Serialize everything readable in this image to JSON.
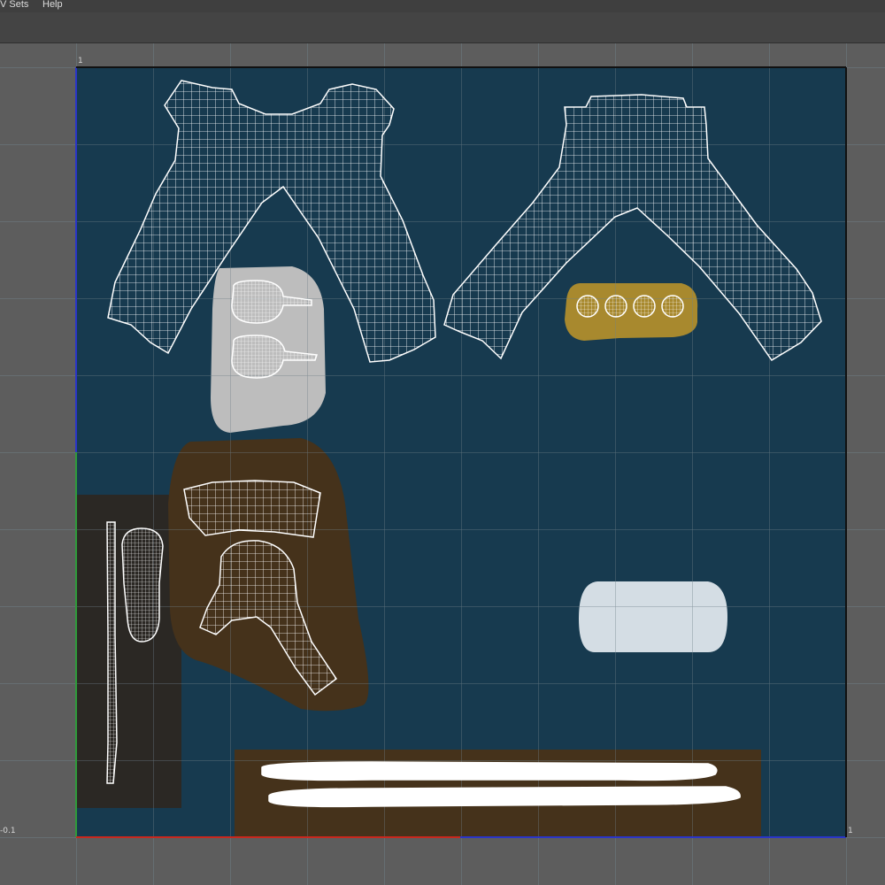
{
  "menubar": {
    "items": [
      {
        "label": "V Sets"
      },
      {
        "label": "Help"
      }
    ]
  },
  "uv_editor": {
    "labels": {
      "top_left": "1",
      "bottom_left": "-0.1",
      "bottom_right": "1"
    },
    "colors": {
      "viewport_background": "#5d5d5d",
      "tile_fill": "#173a4f",
      "grid_line": "#6f7f88",
      "uv_wire": "#ffffff",
      "u_axis": "#c8281e",
      "v_axis": "#2e9a3a",
      "tile_border_blue": "#2a35c8"
    },
    "texture_regions": [
      {
        "name": "grey-patch",
        "color": "#bdbdbd"
      },
      {
        "name": "gold-buttons-patch",
        "color": "#a8892e"
      },
      {
        "name": "brown-boot-patch",
        "color": "#45321b"
      },
      {
        "name": "dark-side-patch",
        "color": "#2b2824"
      },
      {
        "name": "light-blue-patch",
        "color": "#d4dde4"
      },
      {
        "name": "brown-strip-patch",
        "color": "#45321b"
      }
    ]
  }
}
